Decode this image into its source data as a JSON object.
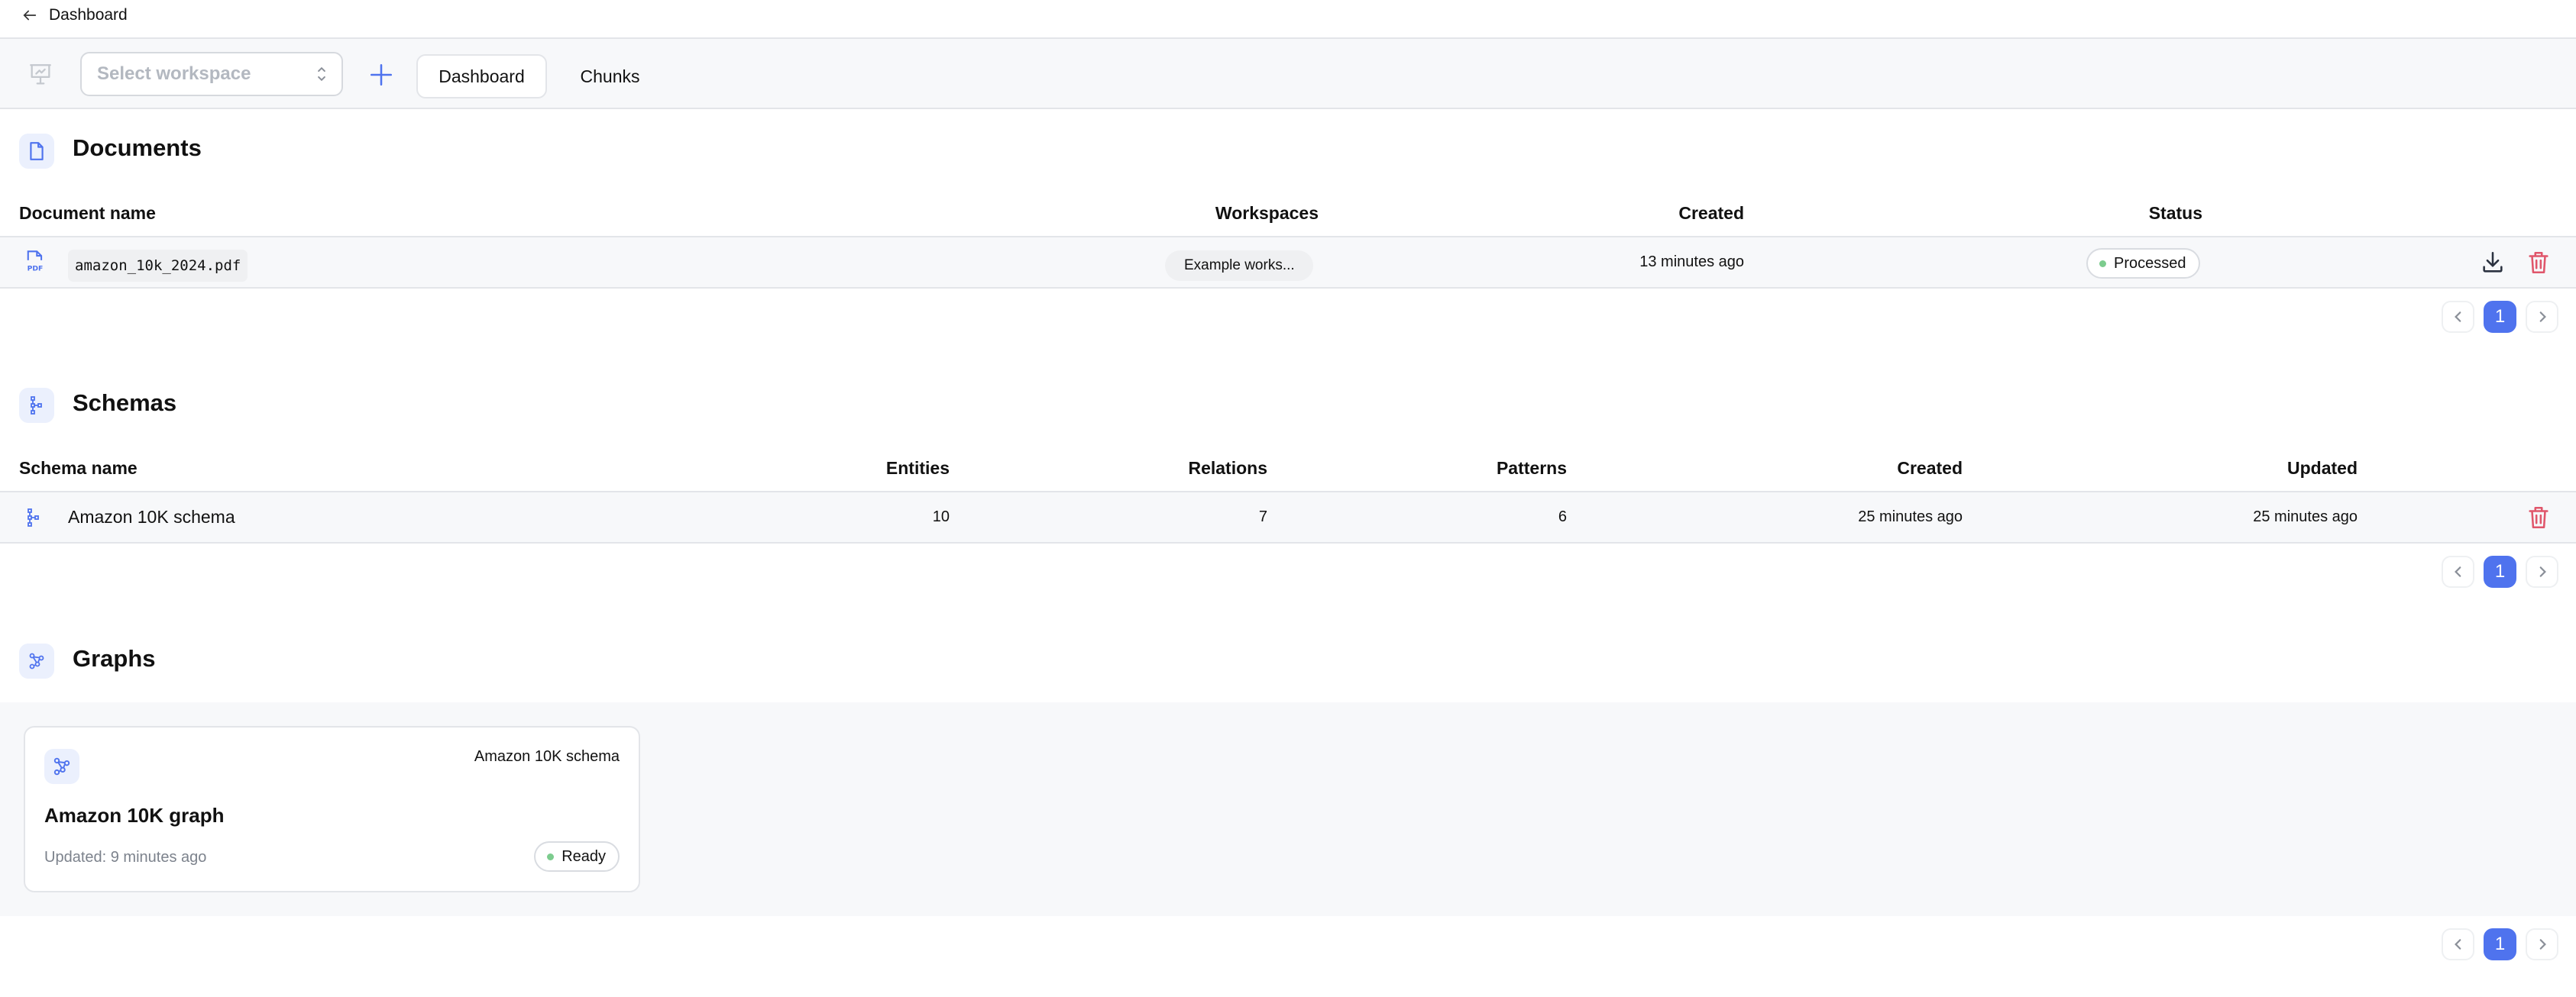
{
  "topbar": {
    "back_label": "Dashboard"
  },
  "toolbar": {
    "workspace_select": {
      "placeholder": "Select workspace"
    },
    "tabs": [
      {
        "label": "Dashboard",
        "active": true
      },
      {
        "label": "Chunks",
        "active": false
      }
    ]
  },
  "documents": {
    "title": "Documents",
    "columns": [
      "Document name",
      "Workspaces",
      "Created",
      "Status"
    ],
    "rows": [
      {
        "file_type": "PDF",
        "name": "amazon_10k_2024.pdf",
        "workspace": "Example works...",
        "created": "13 minutes ago",
        "status": "Processed"
      }
    ],
    "pagination": {
      "current_page": "1"
    }
  },
  "schemas": {
    "title": "Schemas",
    "columns": [
      "Schema name",
      "Entities",
      "Relations",
      "Patterns",
      "Created",
      "Updated"
    ],
    "rows": [
      {
        "name": "Amazon 10K schema",
        "entities": "10",
        "relations": "7",
        "patterns": "6",
        "created": "25 minutes ago",
        "updated": "25 minutes ago"
      }
    ],
    "pagination": {
      "current_page": "1"
    }
  },
  "graphs": {
    "title": "Graphs",
    "cards": [
      {
        "title": "Amazon 10K graph",
        "schema": "Amazon 10K schema",
        "updated": "Updated: 9 minutes ago",
        "status": "Ready"
      }
    ],
    "pagination": {
      "current_page": "1"
    }
  },
  "colors": {
    "accent": "#4f73ee",
    "icon_bg": "#ebf0fd",
    "success_dot": "#7ccc8e",
    "danger": "#e0566b",
    "row_bg": "#f7f8fa"
  }
}
